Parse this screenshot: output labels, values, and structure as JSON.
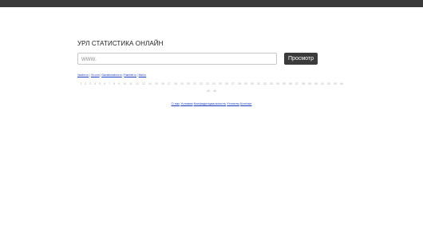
{
  "page": {
    "title": "УРЛ СТАТИСТИКА ОНЛАЙН"
  },
  "search": {
    "placeholder": "www.",
    "value": "",
    "button_label": "Просмотр"
  },
  "recent_links": [
    "Vandex.ru",
    "Vk.com",
    "Glavadomainov.ru",
    "Rambler.ru",
    "Mail.ru"
  ],
  "pager": {
    "pages": [
      "1",
      "2",
      "3",
      "4",
      "5",
      "6",
      "7",
      "8",
      "9",
      "10",
      "11",
      "12",
      "13",
      "14",
      "15",
      "16",
      "17",
      "18",
      "19",
      "20",
      "21",
      "22",
      "23",
      "24",
      "25",
      "26",
      "27",
      "28",
      "29",
      "30",
      "31",
      "32",
      "33",
      "34",
      "35",
      "36",
      "37",
      "38",
      "39",
      "40",
      "41",
      "42",
      "43",
      "44",
      "45",
      "46"
    ]
  },
  "footer": {
    "links": [
      "О нас",
      "Условия",
      "Конфиденциальность",
      "Утилиты",
      "Контакт"
    ]
  },
  "colors": {
    "topbar": "#3a3a3a",
    "button": "#3b3b3b",
    "link": "#1a3fc2"
  }
}
